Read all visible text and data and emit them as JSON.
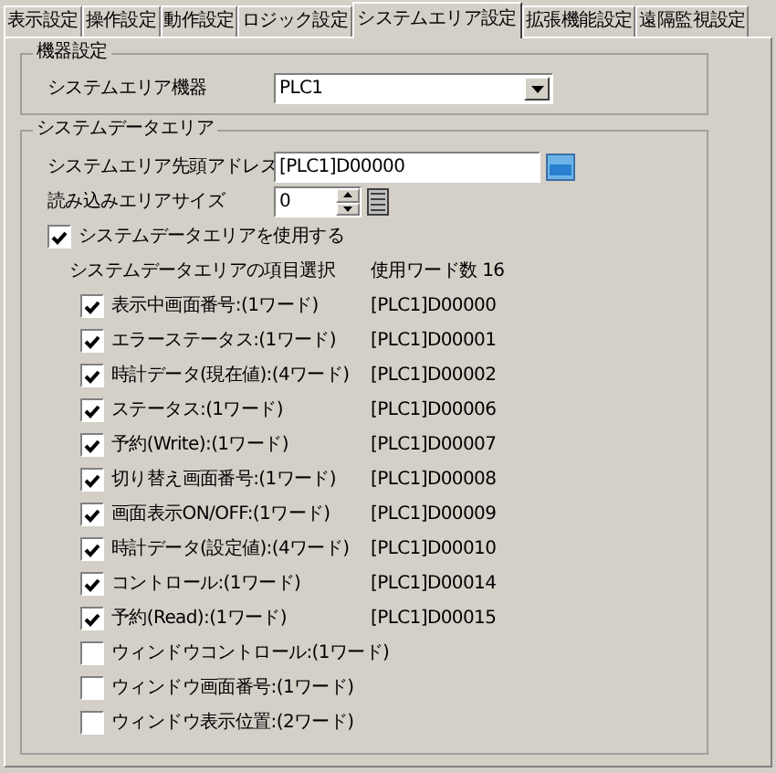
{
  "tabs": [
    {
      "label": "表示設定",
      "selected": false
    },
    {
      "label": "操作設定",
      "selected": false
    },
    {
      "label": "動作設定",
      "selected": false
    },
    {
      "label": "ロジック設定",
      "selected": false
    },
    {
      "label": "システムエリア設定",
      "selected": true
    },
    {
      "label": "拡張機能設定",
      "selected": false
    },
    {
      "label": "遠隔監視設定",
      "selected": false
    }
  ],
  "device_group": {
    "title": "機器設定",
    "label": "システムエリア機器",
    "value": "PLC1"
  },
  "data_group": {
    "title": "システムデータエリア",
    "start_address": {
      "label": "システムエリア先頭アドレス",
      "value": "[PLC1]D00000"
    },
    "read_size": {
      "label": "読み込みエリアサイズ",
      "value": "0"
    },
    "use_area": {
      "label": "システムデータエリアを使用する",
      "checked": true
    },
    "items_header": "システムデータエリアの項目選択",
    "word_count": "使用ワード数 16",
    "items": [
      {
        "label": "表示中画面番号:(1ワード)",
        "checked": true,
        "address": "[PLC1]D00000"
      },
      {
        "label": "エラーステータス:(1ワード)",
        "checked": true,
        "address": "[PLC1]D00001"
      },
      {
        "label": "時計データ(現在値):(4ワード)",
        "checked": true,
        "address": "[PLC1]D00002"
      },
      {
        "label": "ステータス:(1ワード)",
        "checked": true,
        "address": "[PLC1]D00006"
      },
      {
        "label": "予約(Write):(1ワード)",
        "checked": true,
        "address": "[PLC1]D00007"
      },
      {
        "label": "切り替え画面番号:(1ワード)",
        "checked": true,
        "address": "[PLC1]D00008"
      },
      {
        "label": "画面表示ON/OFF:(1ワード)",
        "checked": true,
        "address": "[PLC1]D00009"
      },
      {
        "label": "時計データ(設定値):(4ワード)",
        "checked": true,
        "address": "[PLC1]D00010"
      },
      {
        "label": "コントロール:(1ワード)",
        "checked": true,
        "address": "[PLC1]D00014"
      },
      {
        "label": "予約(Read):(1ワード)",
        "checked": true,
        "address": "[PLC1]D00015"
      },
      {
        "label": "ウィンドウコントロール:(1ワード)",
        "checked": false
      },
      {
        "label": "ウィンドウ画面番号:(1ワード)",
        "checked": false
      },
      {
        "label": "ウィンドウ表示位置:(2ワード)",
        "checked": false
      }
    ]
  }
}
